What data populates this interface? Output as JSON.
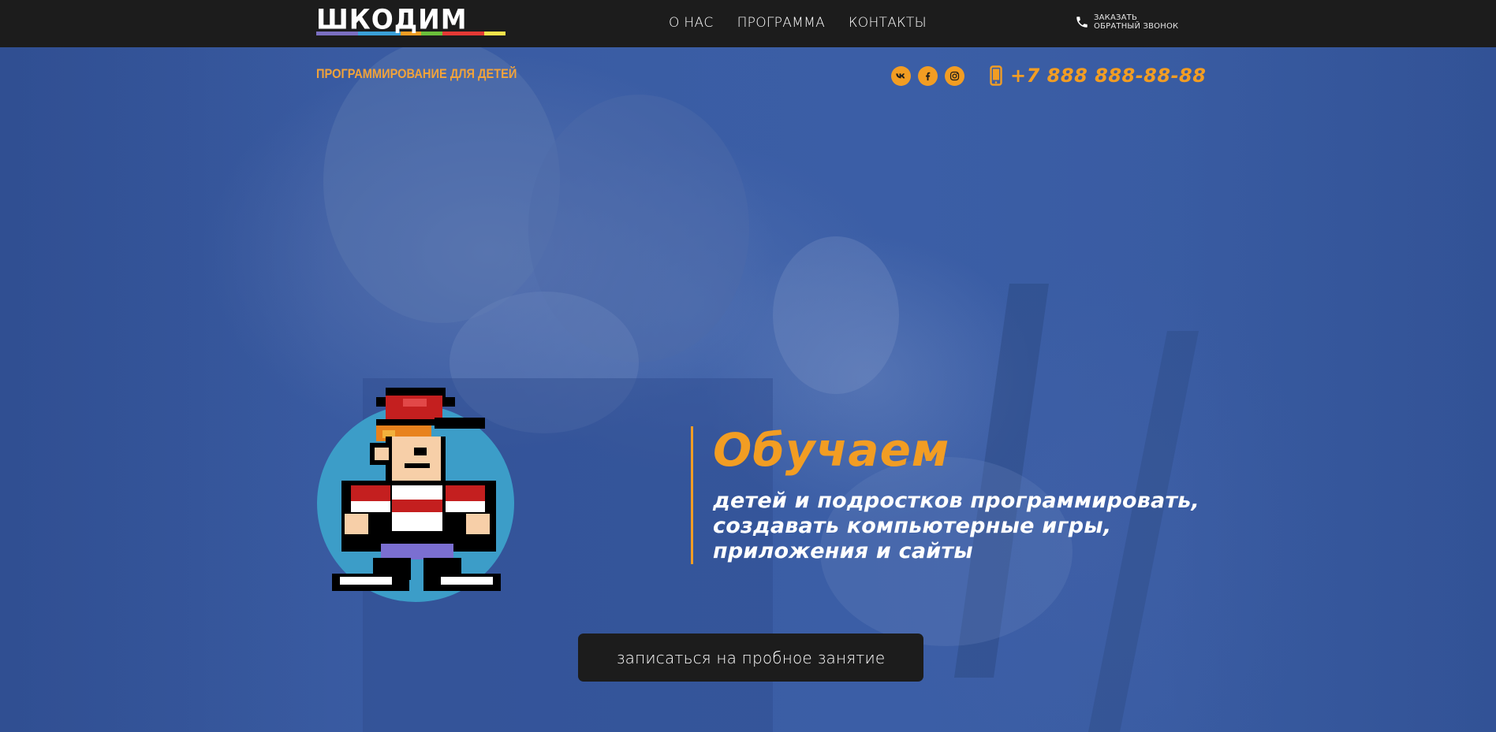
{
  "header": {
    "logo_text": "ШКОДИМ",
    "logo_stripe_colors": [
      "#7b6fc1",
      "#7b6fc1",
      "#3aa0d8",
      "#3aa0d8",
      "#f29d23",
      "#6bbf3a",
      "#e53935",
      "#e53935",
      "#f7e34a"
    ],
    "nav": [
      {
        "label": "О НАС"
      },
      {
        "label": "ПРОГРАММА"
      },
      {
        "label": "КОНТАКТЫ"
      }
    ],
    "callback": {
      "line1": "ЗАКАЗАТЬ",
      "line2": "ОБРАТНЫЙ ЗВОНОК",
      "icon": "phone-icon"
    }
  },
  "subheader": {
    "tagline": "ПРОГРАММИРОВАНИЕ ДЛЯ ДЕТЕЙ",
    "socials": [
      {
        "icon": "vk-icon"
      },
      {
        "icon": "facebook-icon"
      },
      {
        "icon": "instagram-icon"
      }
    ],
    "phone": "+7 888 888-88-88",
    "phone_icon": "mobile-phone-icon"
  },
  "hero": {
    "headline": "Обучаем",
    "sub_lines": [
      "детей и подростков программировать,",
      "создавать компьютерные игры,",
      "приложения и сайты"
    ],
    "cta_label": "записаться на пробное занятие"
  },
  "colors": {
    "accent": "#f29d23",
    "topbar": "#1c1c1c",
    "hero_bg": "#3a5a9e",
    "mascot_circle": "#3c9dc8"
  }
}
